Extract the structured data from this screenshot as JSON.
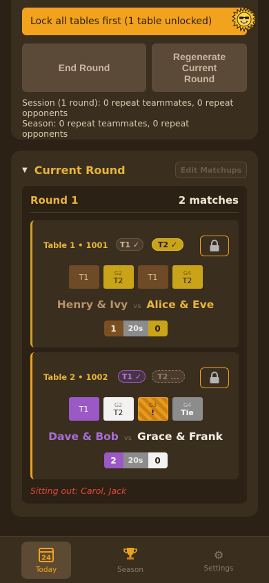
{
  "banner": {
    "text": "Lock all tables first (1 table unlocked)"
  },
  "actions": {
    "end_round": "End Round",
    "regenerate": "Regenerate Current Round"
  },
  "stats": {
    "session": "Session (1 round): 0 repeat teammates, 0 repeat opponents",
    "season": "Season: 0 repeat teammates, 0 repeat opponents"
  },
  "current_round": {
    "title": "Current Round",
    "edit_label": "Edit Matchups",
    "round_name": "Round 1",
    "match_count": "2 matches",
    "matches": [
      {
        "table": "Table 1 • 1001",
        "pills": [
          "T1 ✓",
          "T2 ✓"
        ],
        "games": [
          {
            "label": "",
            "result": "T1"
          },
          {
            "label": "G2",
            "result": "T2"
          },
          {
            "label": "",
            "result": "T1"
          },
          {
            "label": "G4",
            "result": "T2"
          }
        ],
        "team1": "Henry & Ivy",
        "vs": "vs",
        "team2": "Alice & Eve",
        "score1": "1",
        "time": "20s",
        "score2": "0"
      },
      {
        "table": "Table 2 • 1002",
        "pills": [
          "T1 ✓",
          "T2 ..."
        ],
        "games": [
          {
            "label": "",
            "result": "T1"
          },
          {
            "label": "G2",
            "result": "T2"
          },
          {
            "label": "G3",
            "result": "!"
          },
          {
            "label": "G4",
            "result": "Tie"
          }
        ],
        "team1": "Dave & Bob",
        "vs": "vs",
        "team2": "Grace & Frank",
        "score1": "2",
        "time": "20s",
        "score2": "0"
      }
    ],
    "sitting_out": "Sitting out: Carol, Jack"
  },
  "nav": {
    "today": "Today",
    "today_day": "24",
    "season": "Season",
    "settings": "Settings"
  },
  "colors": {
    "accent": "#f2a21c",
    "gold": "#e8b43a",
    "purple": "#9b59c6",
    "danger": "#e2483a"
  },
  "icons": [
    "sun-mascot-icon",
    "lock-icon",
    "calendar-icon",
    "trophy-icon",
    "gear-icon",
    "chevron-down-icon"
  ]
}
